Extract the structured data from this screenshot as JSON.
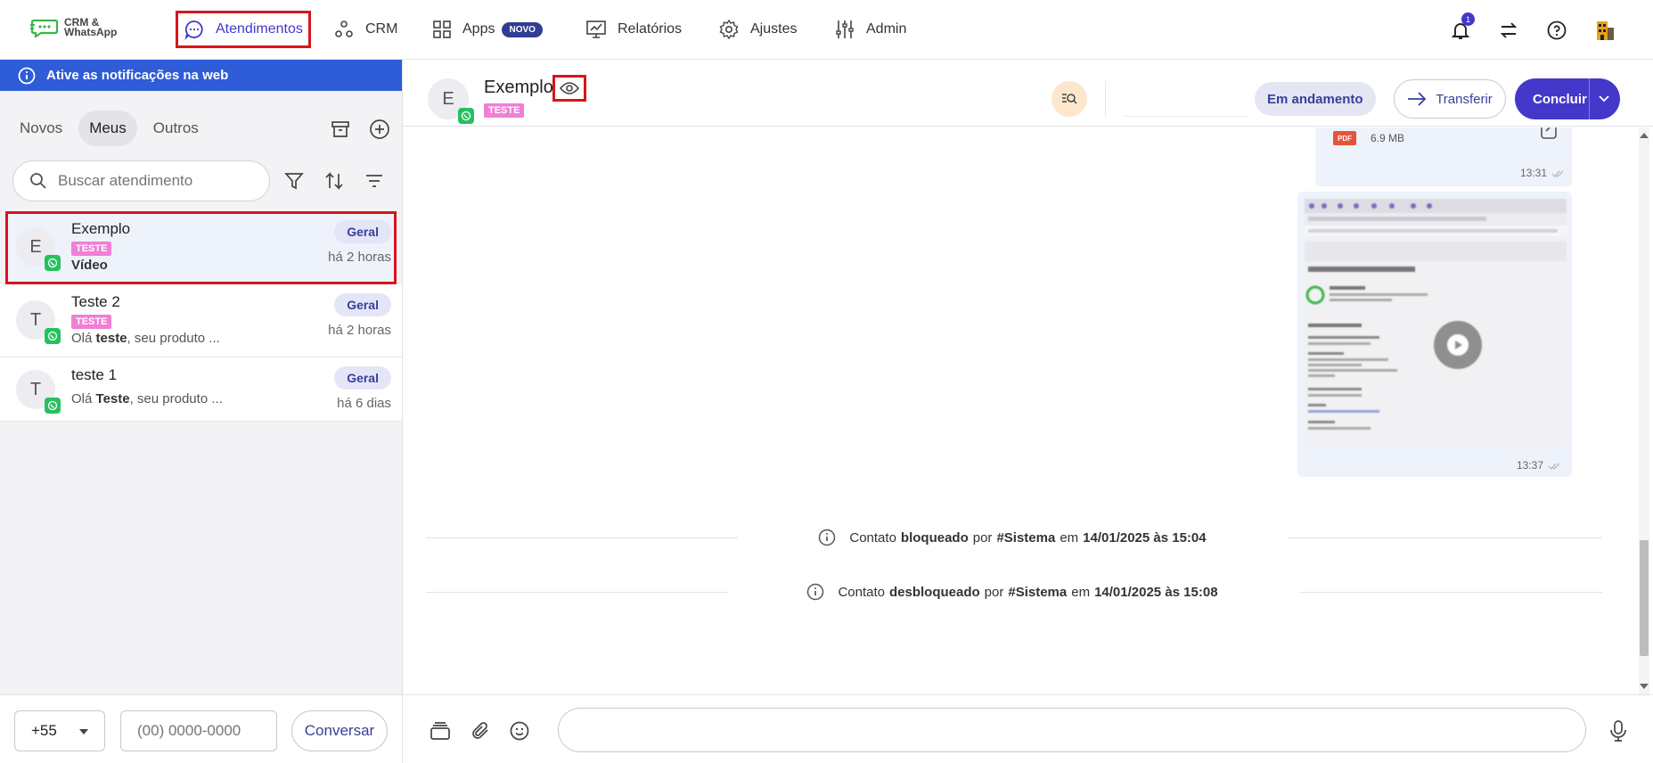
{
  "app": {
    "logo_line1": "CRM &",
    "logo_line2": "WhatsApp"
  },
  "nav": {
    "items": [
      {
        "label": "Atendimentos",
        "icon": "chat-bubble-icon",
        "active": true
      },
      {
        "label": "CRM",
        "icon": "nodes-icon"
      },
      {
        "label": "Apps",
        "icon": "grid-icon",
        "badge": "NOVO"
      },
      {
        "label": "Relatórios",
        "icon": "chart-board-icon"
      },
      {
        "label": "Ajustes",
        "icon": "gear-icon"
      },
      {
        "label": "Admin",
        "icon": "sliders-icon"
      }
    ],
    "notification_count": "1"
  },
  "left_panel": {
    "notify_banner": "Ative as notificações na web",
    "tabs": [
      "Novos",
      "Meus",
      "Outros"
    ],
    "active_tab": "Meus",
    "search_placeholder": "Buscar atendimento",
    "conversations": [
      {
        "initial": "E",
        "name": "Exemplo",
        "tag": "TESTE",
        "preview_bold": "Vídeo",
        "preview_rest": "",
        "dept": "Geral",
        "time": "há 2 horas",
        "selected": true
      },
      {
        "initial": "T",
        "name": "Teste 2",
        "tag": "TESTE",
        "preview_prefix": "Olá ",
        "preview_bold": "teste",
        "preview_rest": ", seu produto ...",
        "dept": "Geral",
        "time": "há 2 horas"
      },
      {
        "initial": "T",
        "name": "teste 1",
        "tag": "",
        "preview_prefix": "Olá ",
        "preview_bold": "Teste",
        "preview_rest": ", seu produto ...",
        "dept": "Geral",
        "time": "há 6 dias"
      }
    ],
    "ddi": "+55",
    "phone_placeholder": "(00) 0000-0000",
    "conversar_label": "Conversar"
  },
  "chat": {
    "contact_initial": "E",
    "contact_name": "Exemplo",
    "contact_tag": "TESTE",
    "status": "Em andamento",
    "transfer_label": "Transferir",
    "conclude_label": "Concluir",
    "messages": [
      {
        "type": "document",
        "file_type": "PDF",
        "size": "6.9 MB",
        "time": "13:31"
      },
      {
        "type": "video",
        "time": "13:37"
      }
    ],
    "system_events": [
      {
        "prefix": "Contato",
        "action": "bloqueado",
        "by_word": "por",
        "by": "#Sistema",
        "on_word": "em",
        "date": "14/01/2025 às 15:04"
      },
      {
        "prefix": "Contato",
        "action": "desbloqueado",
        "by_word": "por",
        "by": "#Sistema",
        "on_word": "em",
        "date": "14/01/2025 às 15:08"
      }
    ],
    "composer_placeholder": ""
  },
  "colors": {
    "accent": "#4338ca",
    "banner": "#2f5cd7",
    "highlight": "#d8141c",
    "tag": "#f07fd6",
    "whatsapp": "#25c15f"
  }
}
